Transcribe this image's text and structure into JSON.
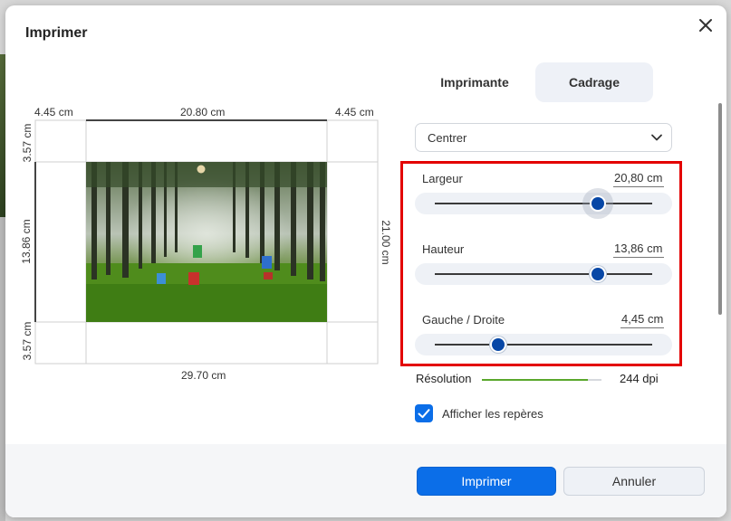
{
  "dialog": {
    "title": "Imprimer"
  },
  "tabs": [
    {
      "label": "Imprimante",
      "active": false
    },
    {
      "label": "Cadrage",
      "active": true
    }
  ],
  "alignment": {
    "selected": "Centrer"
  },
  "sliders": [
    {
      "label": "Largeur",
      "value": "20,80",
      "unit": "cm",
      "level": 0.75
    },
    {
      "label": "Hauteur",
      "value": "13,86",
      "unit": "cm",
      "level": 0.75
    },
    {
      "label": "Gauche / Droite",
      "value": "4,45",
      "unit": "cm",
      "level": 0.29
    }
  ],
  "resolution": {
    "label": "Résolution",
    "value": "244 dpi",
    "level": 0.89,
    "color": "#5aa82c"
  },
  "guides": {
    "label": "Afficher les repères",
    "checked": true
  },
  "preview": {
    "margin_left": "4.45 cm",
    "image_width": "20.80 cm",
    "margin_right": "4.45 cm",
    "margin_top": "3.57 cm",
    "image_height": "13.86 cm",
    "margin_bottom": "3.57 cm",
    "page_width": "29.70 cm",
    "page_height": "21.00 cm"
  },
  "buttons": {
    "print": "Imprimer",
    "cancel": "Annuler"
  },
  "colors": {
    "accent": "#0b6ee8",
    "highlight_border": "#e30000",
    "thumb": "#0747a6"
  }
}
